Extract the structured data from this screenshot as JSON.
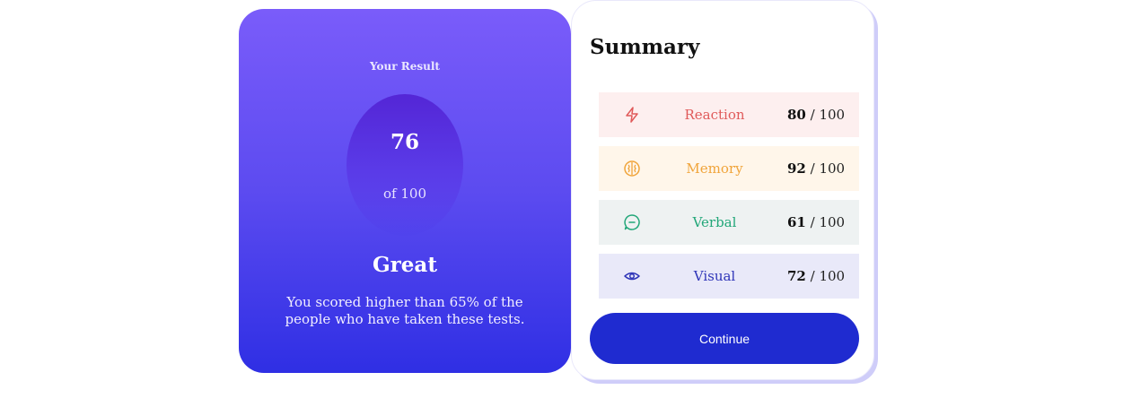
{
  "result": {
    "heading": "Your Result",
    "score": "76",
    "out_of": "of 100",
    "verdict": "Great",
    "description": "You scored higher than 65% of the people who have taken these tests."
  },
  "summary": {
    "title": "Summary",
    "items": [
      {
        "label": "Reaction",
        "score": "80",
        "max": " / 100",
        "icon": "lightning-icon",
        "color": "#e05a5a",
        "background": "#fdefef"
      },
      {
        "label": "Memory",
        "score": "92",
        "max": " / 100",
        "icon": "brain-icon",
        "color": "#f0a43a",
        "background": "#fff6ea"
      },
      {
        "label": "Verbal",
        "score": "61",
        "max": " / 100",
        "icon": "chat-bubble-icon",
        "color": "#22a779",
        "background": "#eef2f2"
      },
      {
        "label": "Visual",
        "score": "72",
        "max": " / 100",
        "icon": "eye-icon",
        "color": "#2f35b8",
        "background": "#e9e9f9"
      }
    ],
    "continue_label": "Continue"
  },
  "colors": {
    "gradient_top": "#7a5cfa",
    "gradient_bottom": "#2f2fe4",
    "button": "#1f2bd0"
  }
}
